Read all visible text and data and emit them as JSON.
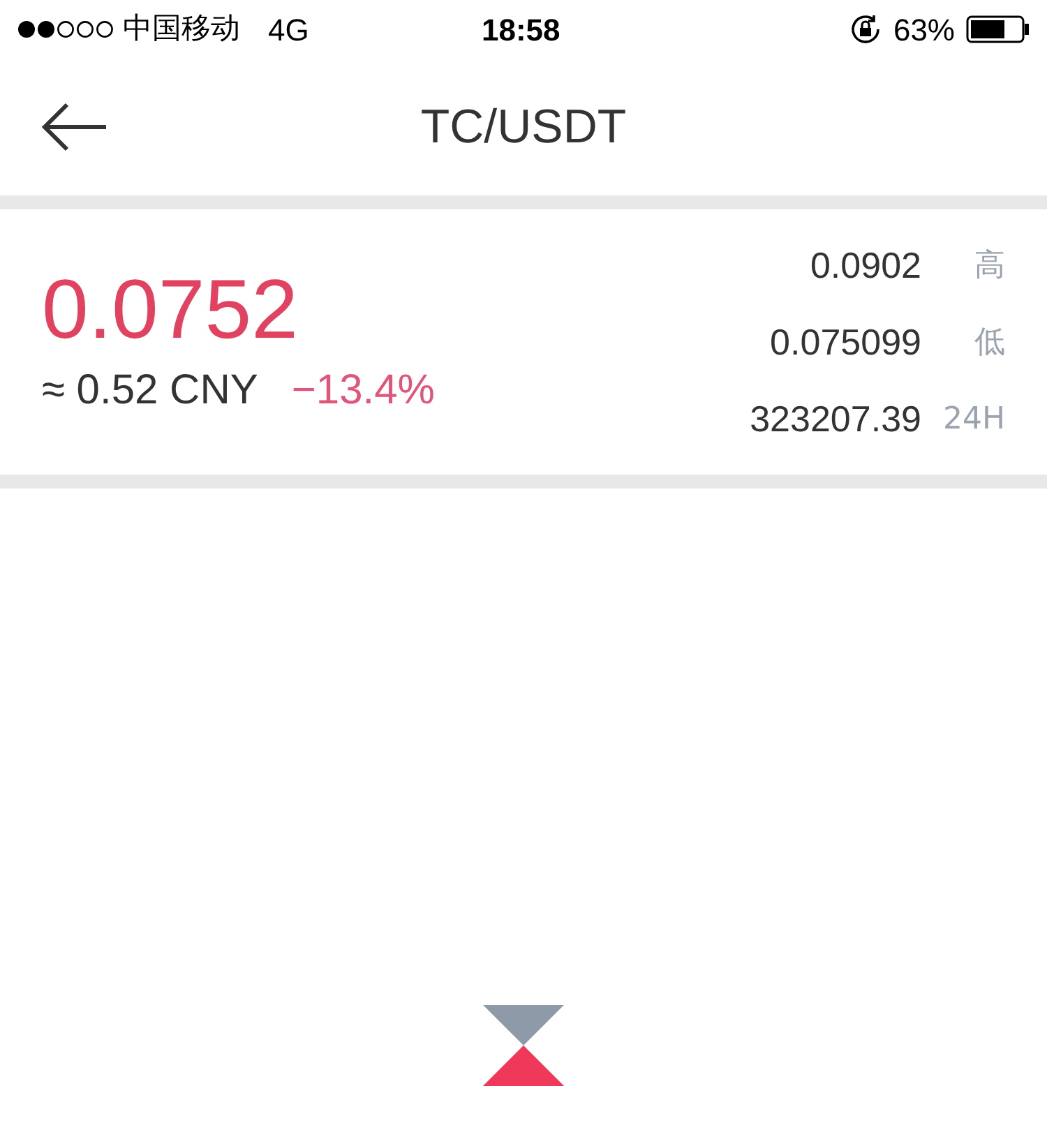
{
  "status_bar": {
    "carrier": "中国移动",
    "network": "4G",
    "time": "18:58",
    "battery": "63%"
  },
  "header": {
    "title": "TC/USDT"
  },
  "ticker": {
    "price": "0.0752",
    "approx": "≈ 0.52 CNY",
    "change": "−13.4%",
    "stats": [
      {
        "value": "0.0902",
        "label": "高"
      },
      {
        "value": "0.075099",
        "label": "低"
      },
      {
        "value": "323207.39",
        "label": "24H"
      }
    ]
  }
}
